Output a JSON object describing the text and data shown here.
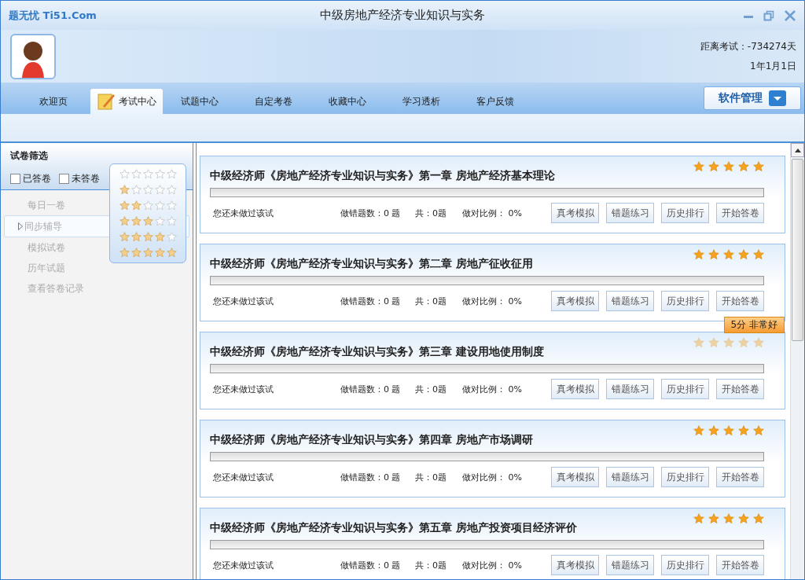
{
  "window": {
    "logo": "题无忧 Ti51.Com",
    "title": "中级房地产经济专业知识与实务"
  },
  "header": {
    "countdown": "距离考试：-734274天",
    "date": "1年1月1日"
  },
  "tabs": [
    {
      "label": "欢迎页",
      "selected": false
    },
    {
      "label": "考试中心",
      "selected": true
    },
    {
      "label": "试题中心",
      "selected": false
    },
    {
      "label": "自定考卷",
      "selected": false
    },
    {
      "label": "收藏中心",
      "selected": false
    },
    {
      "label": "学习透析",
      "selected": false
    },
    {
      "label": "客户反馈",
      "selected": false
    }
  ],
  "menu_button": "软件管理",
  "sidebar": {
    "title": "试卷筛选",
    "filters": [
      {
        "label": "已答卷",
        "checked": false
      },
      {
        "label": "未答卷",
        "checked": false
      }
    ],
    "items": [
      {
        "label": "每日一卷",
        "selected": false
      },
      {
        "label": "同步辅导",
        "selected": true
      },
      {
        "label": "模拟试卷",
        "selected": false
      },
      {
        "label": "历年试题",
        "selected": false
      },
      {
        "label": "查看答卷记录",
        "selected": false
      }
    ],
    "rating_filter": [
      {
        "stars": 0
      },
      {
        "stars": 1
      },
      {
        "stars": 2
      },
      {
        "stars": 3
      },
      {
        "stars": 4
      },
      {
        "stars": 5
      }
    ]
  },
  "papers": [
    {
      "title": "中级经济师《房地产经济专业知识与实务》第一章  房地产经济基本理论",
      "stars": 5,
      "level": 0,
      "status": "您还未做过该试",
      "wrong": "做错题数：0 题",
      "total": "共：0题",
      "ratio": "做对比例： 0%",
      "buttons": [
        "真考模拟",
        "错题练习",
        "历史排行",
        "开始答卷"
      ]
    },
    {
      "title": "中级经济师《房地产经济专业知识与实务》第二章  房地产征收征用",
      "stars": 5,
      "level": 0,
      "status": "您还未做过该试",
      "wrong": "做错题数：0 题",
      "total": "共：0题",
      "ratio": "做对比例： 0%",
      "buttons": [
        "真考模拟",
        "错题练习",
        "历史排行",
        "开始答卷"
      ]
    },
    {
      "title": "中级经济师《房地产经济专业知识与实务》第三章  建设用地使用制度",
      "stars": 5,
      "level": 0,
      "tooltip": "5分  非常好",
      "status": "您还未做过该试",
      "wrong": "做错题数：0 题",
      "total": "共：0题",
      "ratio": "做对比例： 0%",
      "buttons": [
        "真考模拟",
        "错题练习",
        "历史排行",
        "开始答卷"
      ]
    },
    {
      "title": "中级经济师《房地产经济专业知识与实务》第四章  房地产市场调研",
      "stars": 5,
      "level": 0,
      "status": "您还未做过该试",
      "wrong": "做错题数：0 题",
      "total": "共：0题",
      "ratio": "做对比例： 0%",
      "buttons": [
        "真考模拟",
        "错题练习",
        "历史排行",
        "开始答卷"
      ]
    },
    {
      "title": "中级经济师《房地产经济专业知识与实务》第五章  房地产投资项目经济评价",
      "stars": 5,
      "level": 0,
      "status": "您还未做过该试",
      "wrong": "做错题数：0 题",
      "total": "共：0题",
      "ratio": "做对比例： 0%",
      "buttons": [
        "真考模拟",
        "错题练习",
        "历史排行",
        "开始答卷"
      ]
    }
  ]
}
